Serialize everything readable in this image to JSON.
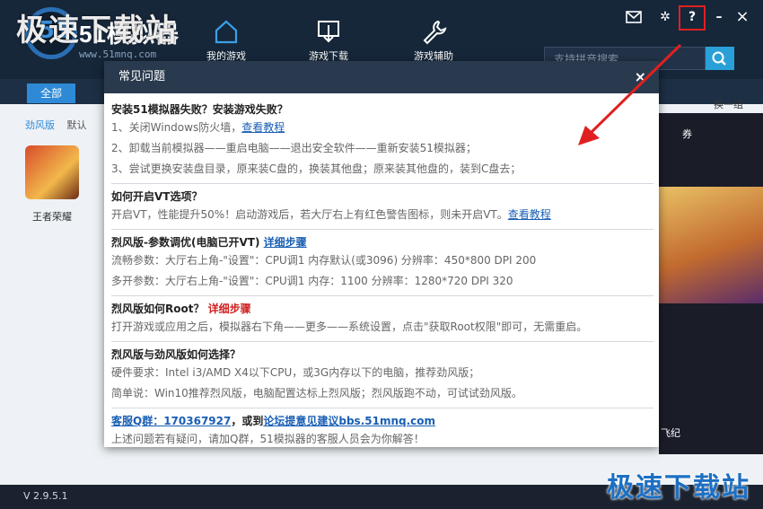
{
  "header": {
    "watermark": "极速下载站",
    "logo_text": "51模拟器",
    "logo_url": "www.51mnq.com",
    "nav": [
      {
        "label": "我的游戏"
      },
      {
        "label": "游戏下载"
      },
      {
        "label": "游戏辅助"
      }
    ],
    "search_placeholder": "支持拼音搜索",
    "help_label": "?",
    "minimize_label": "–",
    "close_label": "×"
  },
  "main": {
    "tab_all": "全部",
    "filter": [
      "劲风版",
      "默认"
    ],
    "game": "王者荣耀",
    "swap": "换一组",
    "right_label1": "券",
    "right_label2": "飞纪"
  },
  "dialog": {
    "title": "常见问题",
    "close": "×",
    "s1": {
      "q": "安装51模拟器失败？安装游戏失败？",
      "a1": "1、关闭Windows防火墙，",
      "a1_link": "查看教程",
      "a2": "2、卸载当前模拟器——重启电脑——退出安全软件——重新安装51模拟器；",
      "a3": "3、尝试更换安装盘目录，原来装C盘的，换装其他盘；原来装其他盘的，装到C盘去；"
    },
    "s2": {
      "q": "如何开启VT选项？",
      "a1": "开启VT，性能提升50%！启动游戏后，若大厅右上有红色警告图标，则未开启VT。",
      "a1_link": "查看教程"
    },
    "s3": {
      "q": "烈风版-参数调优(电脑已开VT)",
      "q_link": "详细步骤",
      "a1": "流畅参数：大厅右上角-\"设置\"：CPU调1 内存默认(或3096) 分辨率：450*800 DPI 200",
      "a2": "多开参数：大厅右上角-\"设置\"：CPU调1 内存：1100 分辨率：1280*720 DPI 320"
    },
    "s4": {
      "q": "烈风版如何Root？",
      "q_link": "详细步骤",
      "a1": "打开游戏或应用之后，模拟器右下角——更多——系统设置，点击\"获取Root权限\"即可，无需重启。"
    },
    "s5": {
      "q": "烈风版与劲风版如何选择？",
      "a1": "硬件要求：Intel i3/AMD X4以下CPU，或3G内存以下的电脑，推荐劲风版；",
      "a2": "简单说：Win10推荐烈风版，电脑配置达标上烈风版；烈风版跑不动，可试试劲风版。"
    },
    "s6": {
      "link1": "客服Q群：170367927",
      "mid": "，或到",
      "link2": "论坛提意见建议bbs.51mnq.com",
      "a1": "上述问题若有疑问，请加Q群，51模拟器的客服人员会为你解答！"
    }
  },
  "status": {
    "version": "V 2.9.5.1",
    "watermark": "极速下载站"
  },
  "colors": {
    "accent": "#2e8ad6",
    "highlight": "#e02020",
    "header_bg": "#16273a"
  }
}
